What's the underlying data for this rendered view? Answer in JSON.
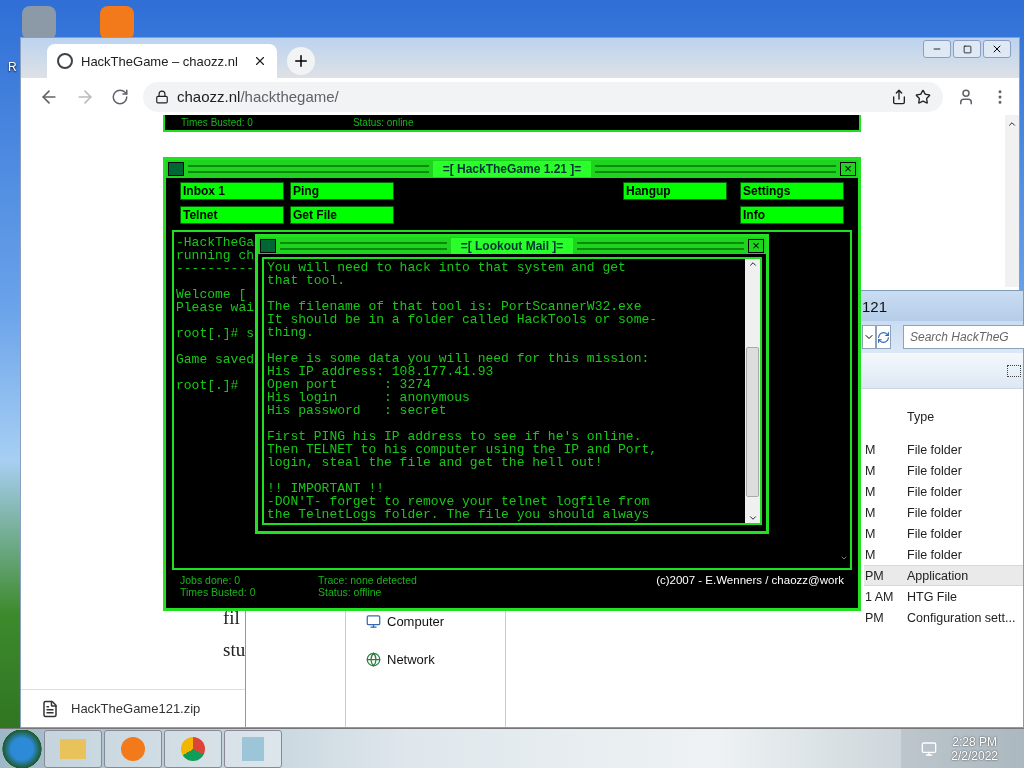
{
  "desktop": {
    "icon_label": "R"
  },
  "browser": {
    "tab_title": "HackTheGame – chaozz.nl",
    "url_host": "chaozz.nl",
    "url_path": "/hackthegame/",
    "top_strip": {
      "times_busted": "Times Busted: 0",
      "status": "Status: online"
    },
    "page_text": [
      "fil",
      "stu"
    ],
    "download": "HackTheGame121.zip"
  },
  "explorer": {
    "title": "121",
    "search_placeholder": "Search HackTheG",
    "columns": [
      "Type"
    ],
    "rows": [
      {
        "column_1": "M",
        "type": "File folder",
        "selected": false
      },
      {
        "column_1": "M",
        "type": "File folder",
        "selected": false
      },
      {
        "column_1": "M",
        "type": "File folder",
        "selected": false
      },
      {
        "column_1": "M",
        "type": "File folder",
        "selected": false
      },
      {
        "column_1": "M",
        "type": "File folder",
        "selected": false
      },
      {
        "column_1": "M",
        "type": "File folder",
        "selected": false
      },
      {
        "column_1": "PM",
        "type": "Application",
        "selected": true
      },
      {
        "column_1": "1 AM",
        "type": "HTG File",
        "selected": false
      },
      {
        "column_1": "PM",
        "type": "Configuration sett...",
        "selected": false
      }
    ],
    "nav": [
      "Computer",
      "Network"
    ]
  },
  "game": {
    "title": "=[ HackTheGame 1.21 ]=",
    "close": "×",
    "buttons": {
      "left_rows": [
        [
          "Inbox 1",
          "Ping"
        ],
        [
          "Telnet",
          "Get File"
        ]
      ],
      "right_rows": [
        [
          "Hangup",
          "Settings"
        ],
        [
          "Info"
        ]
      ]
    },
    "terminal": [
      [
        "-HackTheGa",
        "running ch",
        "----------"
      ],
      [
        "Welcome [",
        "Please wai"
      ],
      [
        "root[.]# s"
      ],
      [
        "Game saved"
      ],
      [
        "root[.]#"
      ]
    ],
    "footer": {
      "left": [
        "Jobs done: 0",
        "Times Busted: 0"
      ],
      "middle": [
        "Trace: none detected",
        "Status: offline"
      ],
      "credit": "(c)2007 - E.Wenners / chaozz@work"
    }
  },
  "mail": {
    "title": "=[ Lookout Mail ]=",
    "close": "×",
    "paragraphs": [
      [
        "You will need to hack into that system and get",
        "that tool."
      ],
      [
        "The filename of that tool is: PortScannerW32.exe",
        "It should be in a folder called HackTools or some-",
        "thing."
      ],
      [
        "Here is some data you will need for this mission:",
        "His IP address: 108.177.41.93",
        "Open port      : 3274",
        "His login      : anonymous",
        "His password   : secret"
      ],
      [
        "First PING his IP address to see if he's online.",
        "Then TELNET to his computer using the IP and Port,",
        "login, steal the file and get the hell out!"
      ],
      [
        "!! IMPORTANT !!",
        "-DON'T- forget to remove your telnet logfile from",
        "the TelnetLogs folder. The file you should always"
      ]
    ]
  },
  "taskbar": {
    "time": "2:28 PM",
    "date": "2/2/2022"
  }
}
